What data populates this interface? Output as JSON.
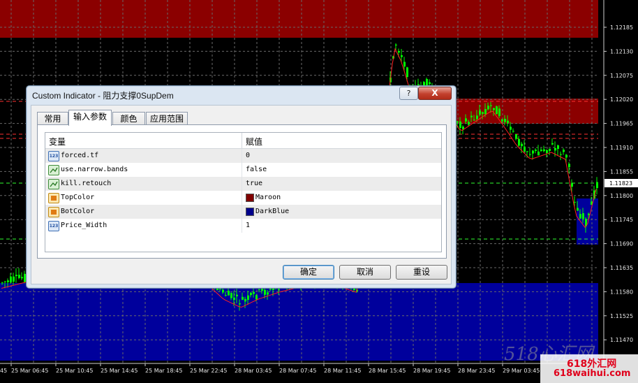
{
  "chart": {
    "price_levels": [
      "1.12185",
      "1.12130",
      "1.12075",
      "1.12020",
      "1.11965",
      "1.11910",
      "1.11855",
      "1.11800",
      "1.11745",
      "1.11690",
      "1.11635",
      "1.11580",
      "1.11525",
      "1.11470"
    ],
    "current_price": "1.11823",
    "time_labels": [
      "25 Mar 06:45",
      "25 Mar 10:45",
      "25 Mar 14:45",
      "25 Mar 18:45",
      "25 Mar 22:45",
      "28 Mar 03:45",
      "28 Mar 07:45",
      "28 Mar 11:45",
      "28 Mar 15:45",
      "28 Mar 19:45",
      "28 Mar 23:45",
      "29 Mar 03:45"
    ],
    "time_label_left_cut": "45",
    "colors": {
      "background": "#000000",
      "candles": "#00ff00",
      "top_zone": "#800000",
      "bottom_zone": "#00008b",
      "ma_line": "#ff0000"
    }
  },
  "dialog": {
    "title": "Custom Indicator - 阻力支撑0SupDem",
    "help_label": "?",
    "close_label": "X",
    "tabs": [
      {
        "label": "常用",
        "active": false
      },
      {
        "label": "输入参数",
        "active": true
      },
      {
        "label": "颜色",
        "active": false
      },
      {
        "label": "应用范围",
        "active": false
      }
    ],
    "columns": {
      "variable": "变量",
      "value": "赋值"
    },
    "params": [
      {
        "icon": "numeric-type-icon",
        "icon_text": "123",
        "name": "forced.tf",
        "value": "0"
      },
      {
        "icon": "bool-type-icon",
        "name": "use.narrow.bands",
        "value": "false"
      },
      {
        "icon": "bool-type-icon",
        "name": "kill.retouch",
        "value": "true"
      },
      {
        "icon": "color-type-icon",
        "name": "TopColor",
        "value": "Maroon",
        "color": "#800000"
      },
      {
        "icon": "color-type-icon",
        "name": "BotColor",
        "value": "DarkBlue",
        "color": "#00008b"
      },
      {
        "icon": "numeric-type-icon",
        "icon_text": "123",
        "name": "Price_Width",
        "value": "1"
      }
    ],
    "buttons": {
      "ok": "确定",
      "cancel": "取消",
      "reset": "重设"
    }
  },
  "watermark": {
    "line1": "618外汇网",
    "line2": "618waihui.com",
    "ghost": "518心汇网"
  }
}
